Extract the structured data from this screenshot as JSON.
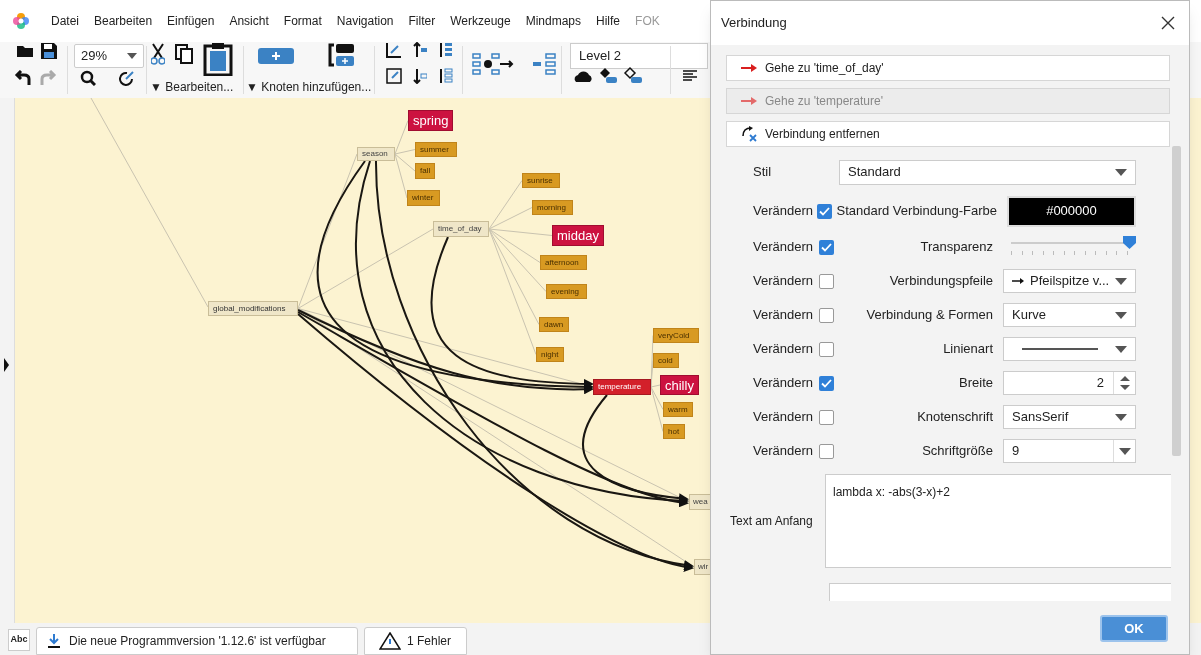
{
  "menu": [
    {
      "label": "Datei",
      "disabled": false
    },
    {
      "label": "Bearbeiten",
      "disabled": false
    },
    {
      "label": "Einfügen",
      "disabled": false
    },
    {
      "label": "Ansicht",
      "disabled": false
    },
    {
      "label": "Format",
      "disabled": false
    },
    {
      "label": "Navigation",
      "disabled": false
    },
    {
      "label": "Filter",
      "disabled": false
    },
    {
      "label": "Werkzeuge",
      "disabled": false
    },
    {
      "label": "Mindmaps",
      "disabled": false
    },
    {
      "label": "Hilfe",
      "disabled": false
    },
    {
      "label": "FOK",
      "disabled": true
    }
  ],
  "toolbar": {
    "zoom": "29%",
    "edit_menu": "▼ Bearbeiten...",
    "add_node_menu": "▼ Knoten hinzufügen...",
    "level": "Level 2"
  },
  "mindmap": {
    "nodes": [
      {
        "text": "global_modifications",
        "kind": "root"
      },
      {
        "text": "season",
        "kind": "group"
      },
      {
        "text": "spring",
        "kind": "highlight"
      },
      {
        "text": "summer",
        "kind": "leaf"
      },
      {
        "text": "fall",
        "kind": "leaf"
      },
      {
        "text": "winter",
        "kind": "leaf"
      },
      {
        "text": "time_of_day",
        "kind": "group"
      },
      {
        "text": "sunrise",
        "kind": "leaf"
      },
      {
        "text": "morning",
        "kind": "leaf"
      },
      {
        "text": "midday",
        "kind": "highlight"
      },
      {
        "text": "afternoon",
        "kind": "leaf"
      },
      {
        "text": "evening",
        "kind": "leaf"
      },
      {
        "text": "dawn",
        "kind": "leaf"
      },
      {
        "text": "night",
        "kind": "leaf"
      },
      {
        "text": "temperature",
        "kind": "active"
      },
      {
        "text": "veryCold",
        "kind": "leaf"
      },
      {
        "text": "cold",
        "kind": "leaf"
      },
      {
        "text": "chilly",
        "kind": "highlight"
      },
      {
        "text": "warm",
        "kind": "leaf"
      },
      {
        "text": "hot",
        "kind": "leaf"
      },
      {
        "text": "wea",
        "kind": "group"
      },
      {
        "text": "wir",
        "kind": "group"
      }
    ]
  },
  "status_bar": {
    "spell": "Abc",
    "update_notice": "Die neue Programmversion '1.12.6' ist verfügbar",
    "errors": "1 Fehler"
  },
  "dialog": {
    "title": "Verbindung",
    "actions": [
      {
        "label": "Gehe zu 'time_of_day'",
        "kind": "goto",
        "disabled": false
      },
      {
        "label": "Gehe zu 'temperature'",
        "kind": "goto",
        "disabled": true
      },
      {
        "label": "Verbindung entfernen",
        "kind": "remove",
        "disabled": false
      }
    ],
    "style": {
      "label": "Stil",
      "value": "Standard"
    },
    "rows": [
      {
        "kind": "color",
        "change": "Verändern",
        "checked": true,
        "label": "Standard Verbindung-Farbe",
        "value": "#000000"
      },
      {
        "kind": "slider",
        "change": "Verändern",
        "checked": true,
        "label": "Transparenz",
        "level": 1
      },
      {
        "kind": "arrow-combo",
        "change": "Verändern",
        "checked": false,
        "label": "Verbindungspfeile",
        "value": "Pfeilspitze v..."
      },
      {
        "kind": "combo",
        "change": "Verändern",
        "checked": false,
        "label": "Verbindung & Formen",
        "value": "Kurve"
      },
      {
        "kind": "line-combo",
        "change": "Verändern",
        "checked": false,
        "label": "Linienart"
      },
      {
        "kind": "spinner",
        "change": "Verändern",
        "checked": true,
        "label": "Breite",
        "value": "2"
      },
      {
        "kind": "combo",
        "change": "Verändern",
        "checked": false,
        "label": "Knotenschrift",
        "value": "SansSerif"
      },
      {
        "kind": "edit-combo",
        "change": "Verändern",
        "checked": false,
        "label": "Schriftgröße",
        "value": "9"
      }
    ],
    "start_text": {
      "label": "Text am Anfang",
      "value": "lambda x: -abs(3-x)+2"
    },
    "ok": "OK"
  }
}
